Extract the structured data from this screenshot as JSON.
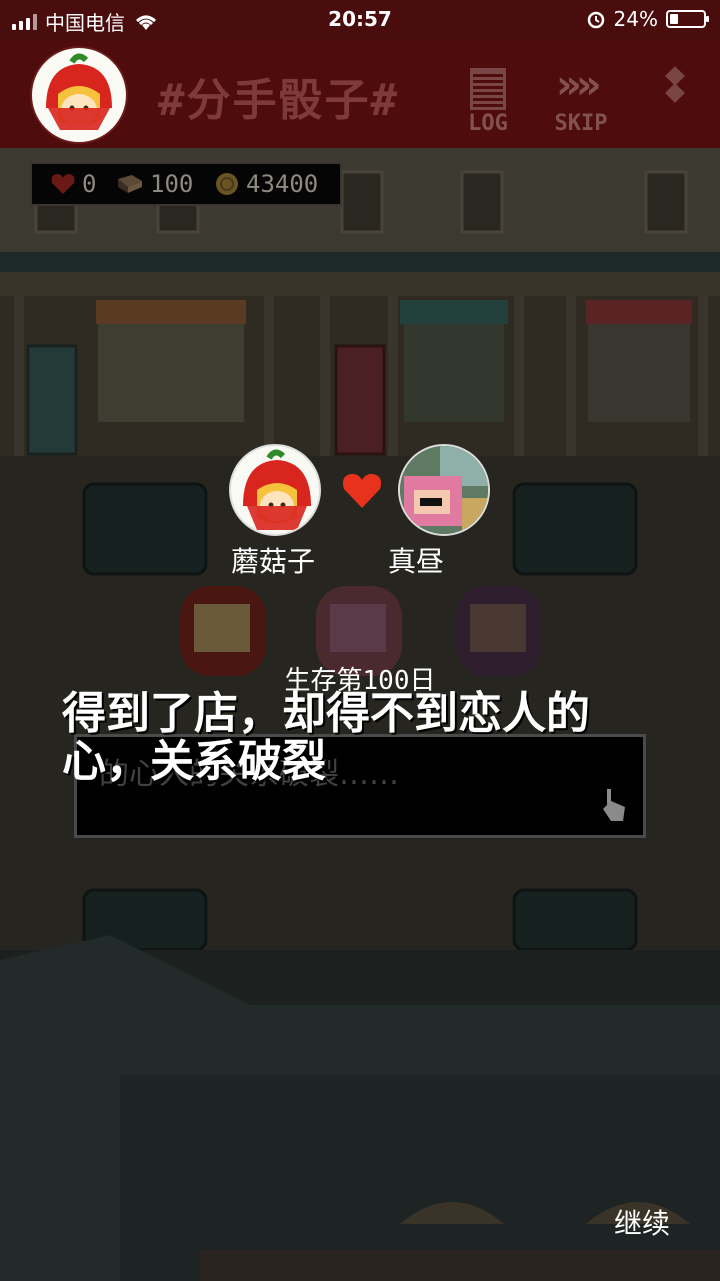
{
  "status_bar": {
    "carrier": "中国电信",
    "time": "20:57",
    "battery": "24%",
    "battery_level": 0.24
  },
  "top_bar": {
    "title": "#分手骰子#",
    "log_label": "LOG",
    "skip_label": "SKIP"
  },
  "hud": {
    "hearts": "0",
    "books": "100",
    "coins": "43400"
  },
  "pair": {
    "left_name": "蘑菇子",
    "right_name": "真昼"
  },
  "story": {
    "day_label": "生存第100日",
    "ending_text": "得到了店，却得不到恋人的心，关系破裂",
    "dialog_text": "的心人的关系破裂……"
  },
  "continue_label": "继续",
  "colors": {
    "topbar": "#4e0c0c",
    "heart": "#e8321e",
    "text": "#ffffff"
  }
}
